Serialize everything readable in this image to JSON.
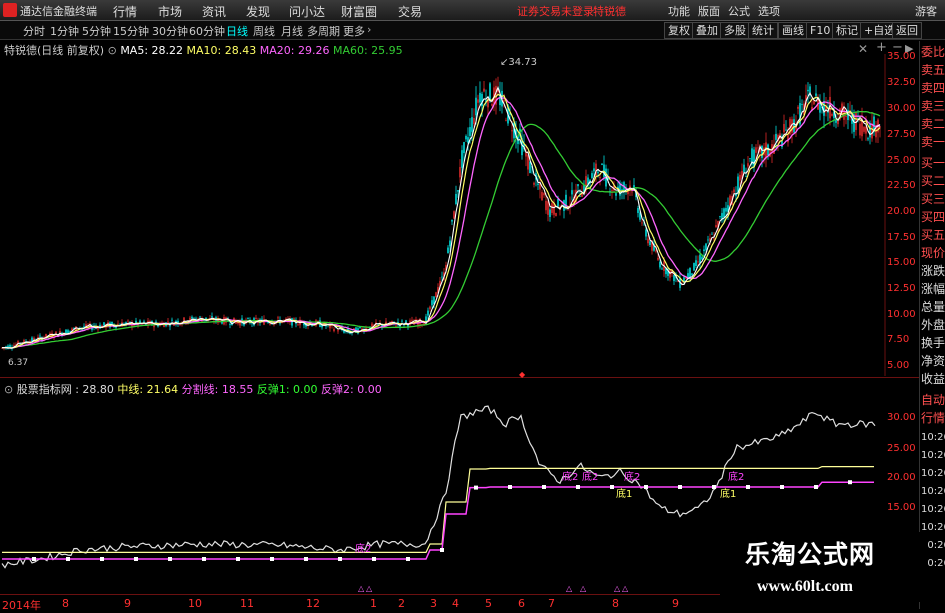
{
  "app": {
    "title": "通达信金融终端"
  },
  "menu": [
    "行情",
    "市场",
    "资讯",
    "发现",
    "问小达",
    "财富圈",
    "交易"
  ],
  "notice": {
    "text1": "证券交易未登录",
    "text2": "特锐德"
  },
  "right_menu": [
    "功能",
    "版面",
    "公式",
    "选项"
  ],
  "guest": "游客",
  "periods": [
    "分时",
    "1分钟",
    "5分钟",
    "15分钟",
    "30分钟",
    "60分钟",
    "日线",
    "周线",
    "月线",
    "多周期",
    "更多"
  ],
  "tools": [
    "复权",
    "叠加",
    "多股",
    "统计",
    "画线",
    "F10",
    "标记",
    "+自选",
    "返回"
  ],
  "main_legend": {
    "name": "特锐德(日线 前复权)",
    "ma5": "MA5: 28.22",
    "ma10": "MA10: 28.43",
    "ma20": "MA20: 29.26",
    "ma60": "MA60: 25.95"
  },
  "peak_label": "34.73",
  "low_label": "6.37",
  "price_axis": [
    "35.00",
    "32.50",
    "30.00",
    "27.50",
    "25.00",
    "22.50",
    "20.00",
    "17.50",
    "15.00",
    "12.50",
    "10.00",
    "7.50",
    "5.00"
  ],
  "sub_legend": {
    "name": "股票指标网 : 28.80",
    "mid": "中线: 21.64",
    "split": "分割线: 18.55",
    "rb1": "反弹1: 0.00",
    "rb2": "反弹2: 0.00"
  },
  "sub_axis": [
    "30.00",
    "25.00",
    "20.00",
    "15.00"
  ],
  "x_axis": [
    "2014年",
    "8",
    "9",
    "10",
    "11",
    "12",
    "1",
    "2",
    "3",
    "4",
    "5",
    "6",
    "7",
    "8",
    "9"
  ],
  "sub_markers": [
    "底2",
    "底2",
    "底2",
    "底1",
    "底2",
    "底2",
    "底1"
  ],
  "right_panel": [
    "委比",
    "卖五",
    "卖四",
    "卖三",
    "卖二",
    "卖一",
    "买一",
    "买二",
    "买三",
    "买四",
    "买五",
    "现价",
    "涨跌",
    "涨幅",
    "总量",
    "外盘",
    "换手",
    "净资",
    "收益",
    "自动",
    "行情",
    "10:26",
    "10:26",
    "10:26",
    "10:26",
    "10:26",
    "10:26",
    "10:26",
    "10:26"
  ],
  "watermark": {
    "title": "乐淘公式网",
    "url": "www.60lt.com"
  },
  "colors": {
    "up": "#ff3030",
    "down": "#00ffff",
    "ma5": "#ffffff",
    "ma10": "#ffff66",
    "ma20": "#ff66ff",
    "ma60": "#33cc33"
  }
}
